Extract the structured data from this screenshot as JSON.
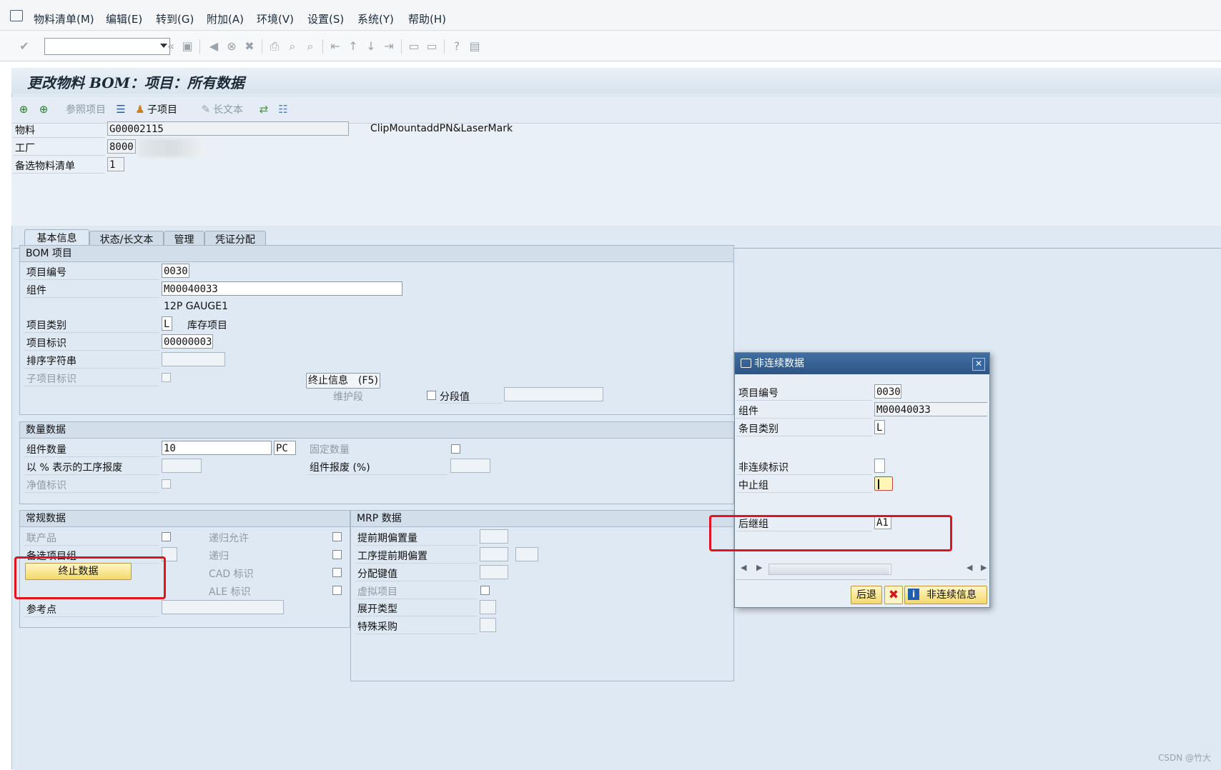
{
  "menu": {
    "items": [
      "物料清单(M)",
      "编辑(E)",
      "转到(G)",
      "附加(A)",
      "环境(V)",
      "设置(S)",
      "系统(Y)",
      "帮助(H)"
    ]
  },
  "title": "更改物料 BOM：项目：所有数据",
  "app_toolbar": {
    "ref_item": "参照项目",
    "sub_item": "子项目",
    "long_text": "长文本"
  },
  "header": {
    "material_label": "物料",
    "material_value": "G00002115",
    "material_desc": "ClipMountaddPN&LaserMark",
    "plant_label": "工厂",
    "plant_value": "8000",
    "alt_bom_label": "备选物料清单",
    "alt_bom_value": "1"
  },
  "tabs": [
    "基本信息",
    "状态/长文本",
    "管理",
    "凭证分配"
  ],
  "bom_item": {
    "title": "BOM 项目",
    "item_no_label": "项目编号",
    "item_no": "0030",
    "component_label": "组件",
    "component": "M00040033",
    "component_desc": "12P GAUGE1",
    "item_cat_label": "项目类别",
    "item_cat": "L",
    "item_cat_desc": "库存项目",
    "item_id_label": "项目标识",
    "item_id": "00000003",
    "sort_label": "排序字符串",
    "sub_item_id_label": "子项目标识",
    "end_info_btn": "终止信息　(F5)",
    "maint_seg_label": "维护段",
    "seg_value_label": "分段值"
  },
  "qty": {
    "title": "数量数据",
    "comp_qty_label": "组件数量",
    "comp_qty": "10",
    "unit": "PC",
    "fixed_qty_label": "固定数量",
    "op_scrap_label": "以 % 表示的工序报废",
    "comp_scrap_label": "组件报废 (%)",
    "net_id_label": "净值标识"
  },
  "general": {
    "title": "常规数据",
    "co_product_label": "联产品",
    "recursive_allowed_label": "递归允许",
    "alt_item_group_label": "备选项目组",
    "recursive_label": "递归",
    "end_data_btn": "终止数据",
    "cad_label": "CAD 标识",
    "ale_label": "ALE 标识",
    "ref_point_label": "参考点"
  },
  "mrp": {
    "title": "MRP 数据",
    "lead_offset_label": "提前期偏置量",
    "op_lead_offset_label": "工序提前期偏置",
    "dist_key_label": "分配键值",
    "phantom_label": "虚拟项目",
    "explosion_type_label": "展开类型",
    "special_proc_label": "特殊采购"
  },
  "dialog": {
    "title": "非连续数据",
    "item_no_label": "项目编号",
    "item_no": "0030",
    "component_label": "组件",
    "component": "M00040033",
    "item_cat_label": "条目类别",
    "item_cat": "L",
    "disc_id_label": "非连续标识",
    "disc_group_label": "中止组",
    "follow_group_label": "后继组",
    "follow_group": "A1",
    "back_btn": "后退",
    "disc_info_btn": "非连续信息"
  },
  "watermark": "CSDN @竹大",
  "colors": {
    "highlight_red": "#e0141e",
    "dialog_title": "#2d5585",
    "panel_bg": "#dfe9f3",
    "button_yellow": "#f4d96b"
  }
}
